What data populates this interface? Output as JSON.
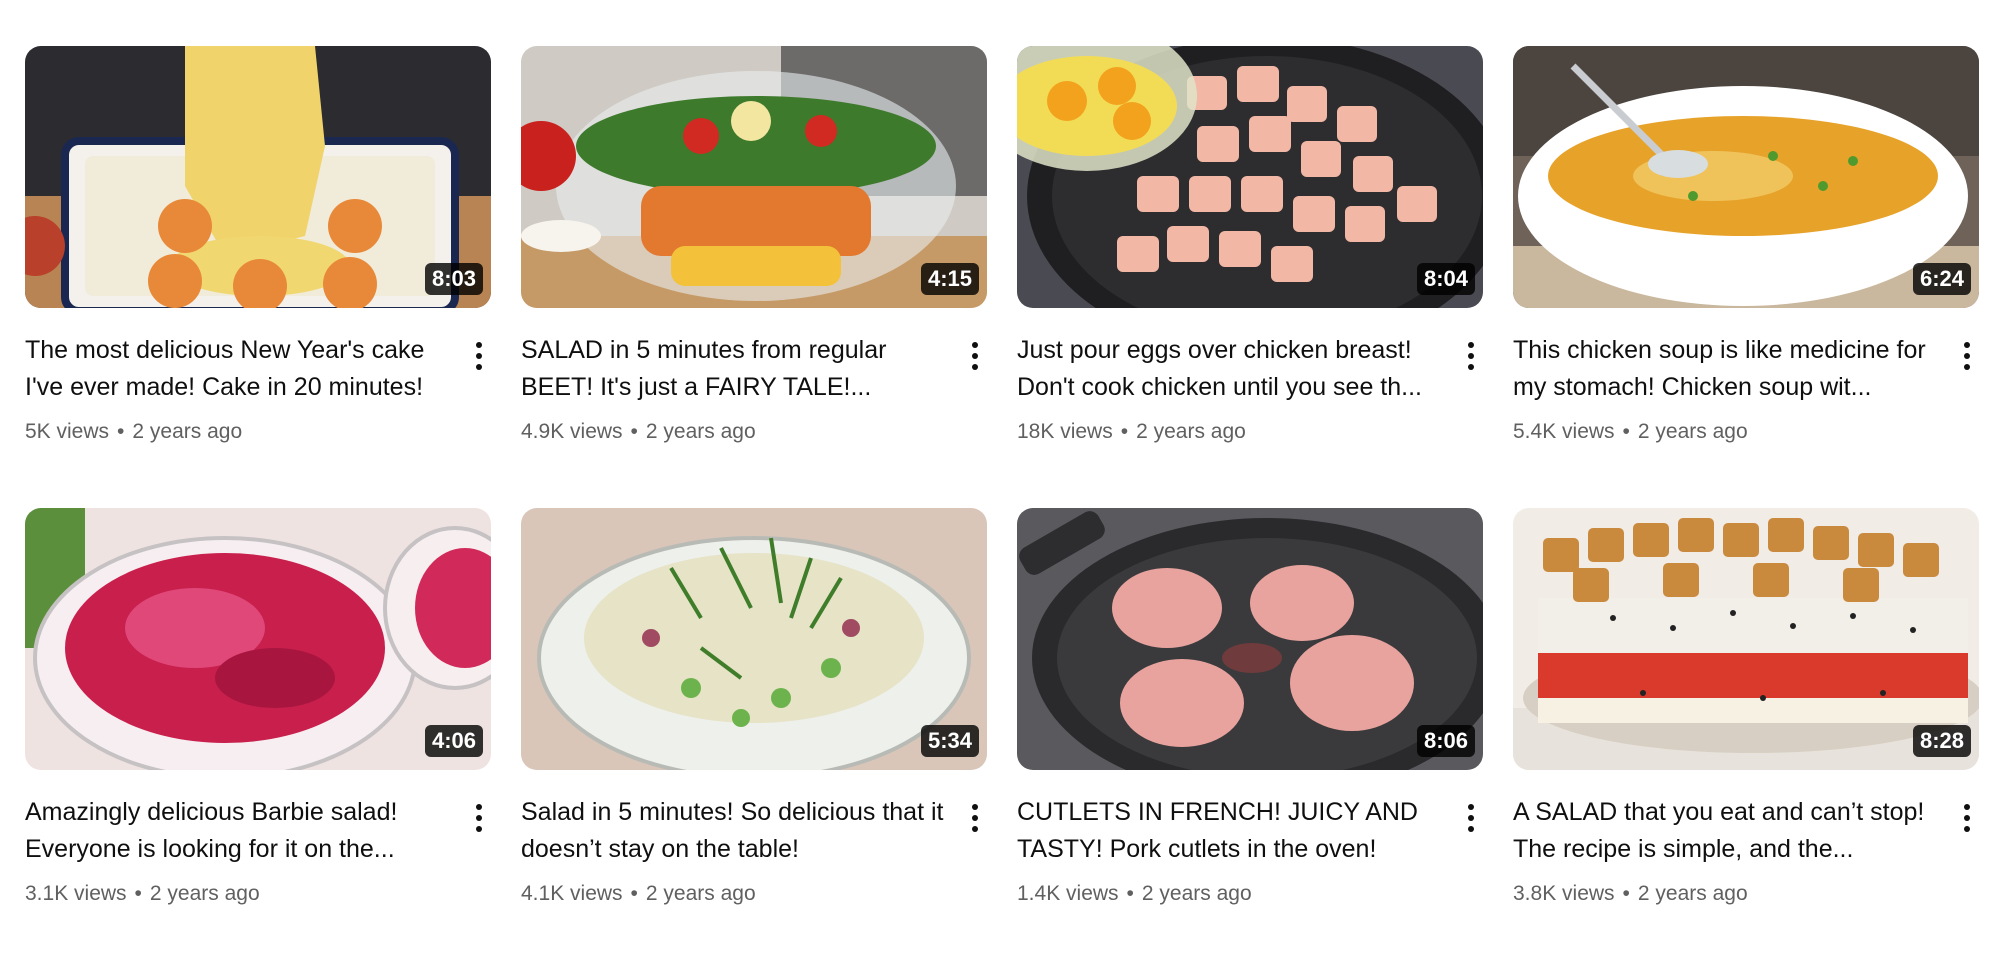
{
  "videos": [
    {
      "title": "The most delicious New Year's cake I've ever made! Cake in 20 minutes!",
      "duration": "8:03",
      "views": "5K views",
      "age": "2 years ago",
      "thumb_colors": [
        "#c9a35a",
        "#f3e7b6",
        "#e08a3a"
      ]
    },
    {
      "title": "SALAD in 5 minutes from regular BEET! It's just a FAIRY TALE!...",
      "duration": "4:15",
      "views": "4.9K views",
      "age": "2 years ago",
      "thumb_colors": [
        "#d9d3cc",
        "#3f7a2e",
        "#d25a2a"
      ]
    },
    {
      "title": "Just pour eggs over chicken breast! Don't cook chicken until you see th...",
      "duration": "8:04",
      "views": "18K views",
      "age": "2 years ago",
      "thumb_colors": [
        "#2e2e33",
        "#f2b8a4",
        "#f2b733"
      ]
    },
    {
      "title": "This chicken soup is like medicine for my stomach! Chicken soup wit...",
      "duration": "6:24",
      "views": "5.4K views",
      "age": "2 years ago",
      "thumb_colors": [
        "#7a6a5c",
        "#ffffff",
        "#e0a12a"
      ]
    },
    {
      "title": "Amazingly delicious Barbie salad! Everyone is looking for it on the...",
      "duration": "4:06",
      "views": "3.1K views",
      "age": "2 years ago",
      "thumb_colors": [
        "#f1e6e6",
        "#c71f4e",
        "#6aa04a"
      ]
    },
    {
      "title": "Salad in 5 minutes! So delicious that it doesn’t stay on the table!",
      "duration": "5:34",
      "views": "4.1K views",
      "age": "2 years ago",
      "thumb_colors": [
        "#d8c8bd",
        "#e4e2c8",
        "#4a8a3a"
      ]
    },
    {
      "title": "CUTLETS IN FRENCH! JUICY AND TASTY! Pork cutlets in the oven!",
      "duration": "8:06",
      "views": "1.4K views",
      "age": "2 years ago",
      "thumb_colors": [
        "#545457",
        "#2a2a2c",
        "#e6a19b"
      ]
    },
    {
      "title": "A SALAD that you eat and can’t stop! The recipe is simple, and the...",
      "duration": "8:28",
      "views": "3.8K views",
      "age": "2 years ago",
      "thumb_colors": [
        "#e9e4dc",
        "#d8402f",
        "#c98a3e"
      ]
    }
  ],
  "separator": "•"
}
